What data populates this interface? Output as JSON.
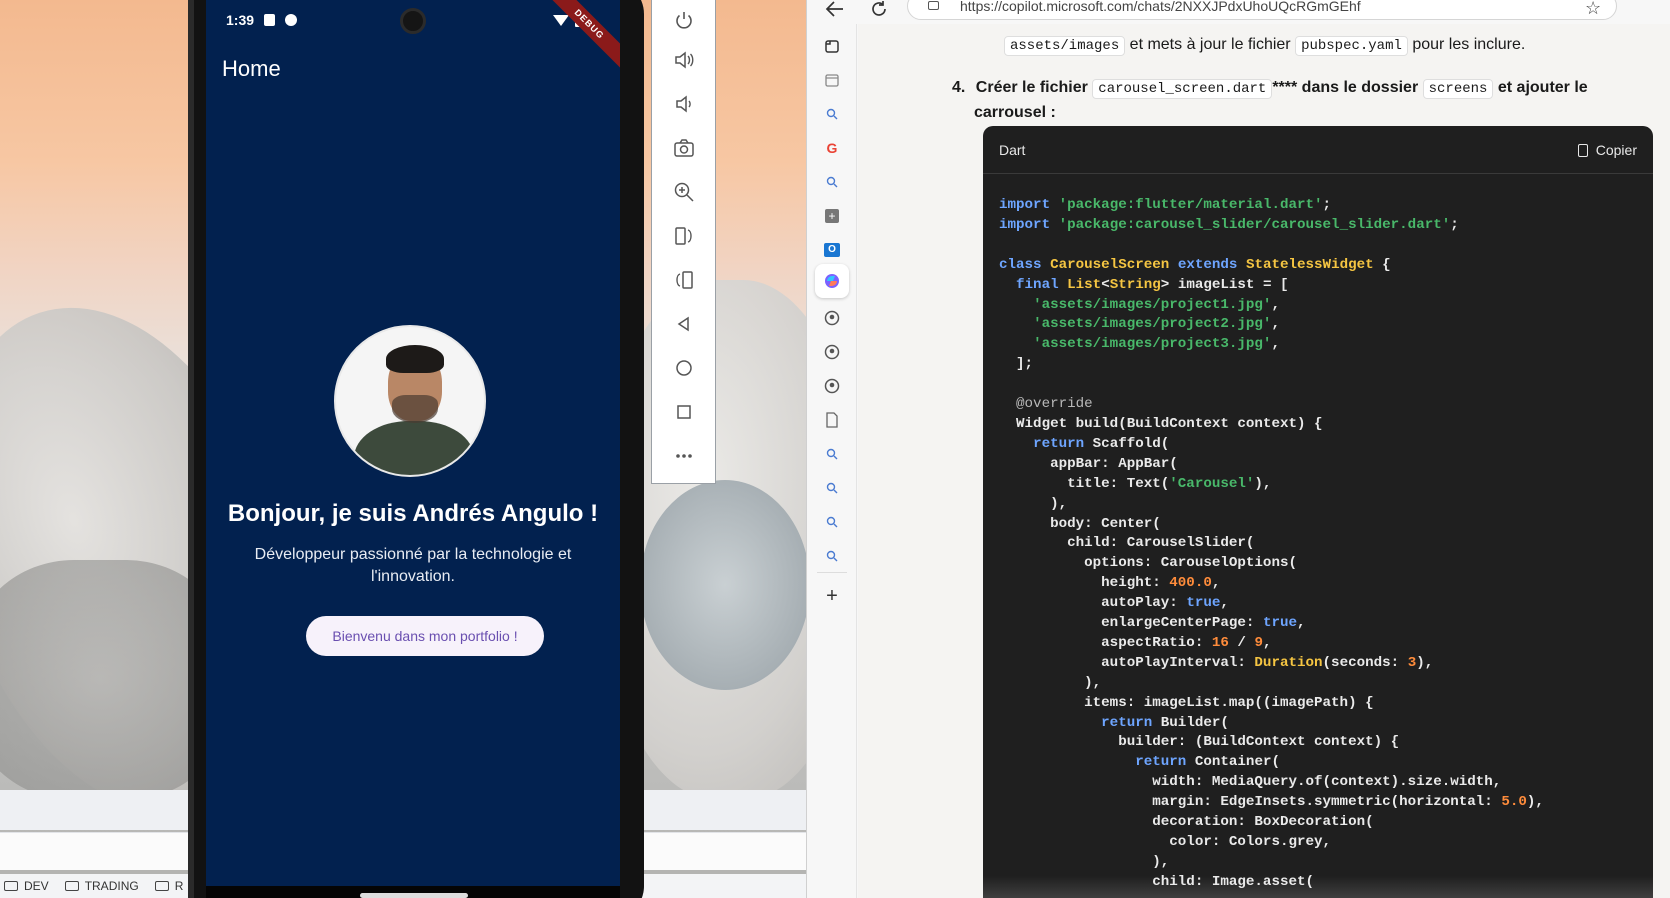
{
  "phone": {
    "status_time": "1:39",
    "debug_label": "DEBUG",
    "app_bar_title": "Home",
    "greeting": "Bonjour, je suis Andrés Angulo !",
    "subtitle": "Développeur passionné par la technologie et l'innovation.",
    "button_label": "Bienvenu dans mon portfolio !",
    "background_color": "#02214f",
    "button_text_color": "#6a4fb0"
  },
  "emulator_toolbar": {
    "icons": [
      "power-icon",
      "volume-up-icon",
      "volume-down-icon",
      "camera-icon",
      "zoom-in-icon",
      "rotate-left-icon",
      "rotate-right-icon",
      "back-icon",
      "home-icon",
      "overview-icon",
      "more-icon"
    ]
  },
  "bookmarks": [
    {
      "label": "DEV"
    },
    {
      "label": "TRADING"
    },
    {
      "label": "R"
    }
  ],
  "browser": {
    "url": "https://copilot.microsoft.com/chats/2NXXJPdxUhoUQcRGmGEhf",
    "sidebar_icons": [
      "tabs-icon",
      "history-icon",
      "search-icon",
      "google-icon",
      "search-icon",
      "add-icon",
      "outlook-icon",
      "copilot-icon",
      "github-icon",
      "github-icon",
      "github-icon",
      "document-icon",
      "search-icon",
      "search-icon",
      "search-icon",
      "search-icon",
      "plus-icon"
    ]
  },
  "chat": {
    "prev_line": {
      "code": "assets/images",
      "text_mid": " et mets à jour le fichier ",
      "code2": "pubspec.yaml",
      "text_end": " pour les inclure."
    },
    "step4": {
      "number": "4.",
      "text_a": "Créer le fichier ",
      "code_a": "carousel_screen.dart",
      "text_b": "**** dans le dossier ",
      "code_b": "screens",
      "text_c": " et ajouter le",
      "text_d": "carrousel :"
    },
    "code_block": {
      "language": "Dart",
      "copy_label": "Copier"
    }
  }
}
